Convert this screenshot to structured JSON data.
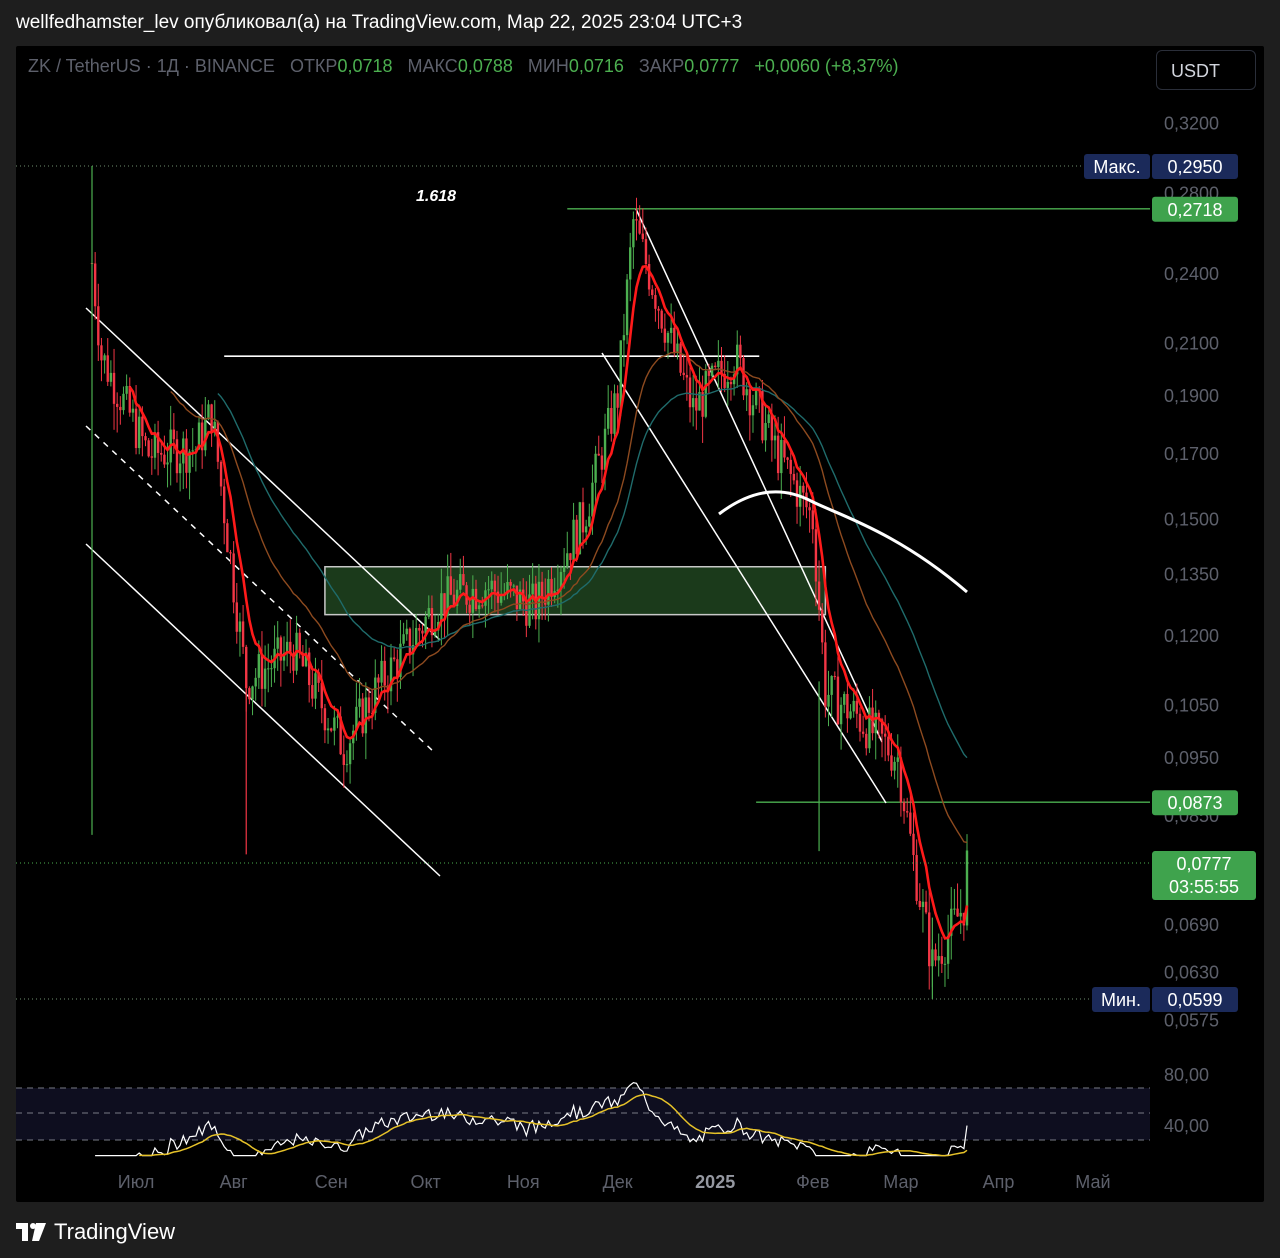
{
  "header": {
    "text": "wellfedhamster_lev опубликовал(а) на TradingView.com, Мар 22, 2025 23:04 UTC+3"
  },
  "legend": {
    "symbol": "ZK / TetherUS · 1Д · BINANCE",
    "open_label": "ОТКР",
    "open": "0,0718",
    "high_label": "МАКС",
    "high": "0,0788",
    "low_label": "МИН",
    "low": "0,0716",
    "close_label": "ЗАКР",
    "close": "0,0777",
    "change": "+0,0060 (+8,37%)"
  },
  "currency_button": "USDT",
  "footer": {
    "brand": "TradingView"
  },
  "colors": {
    "up": "#4caf50",
    "down": "#f23645",
    "ema_fast": "#ff1a1a",
    "ema_mid": "#8d4a1f",
    "ema_slow": "#1f6b6b",
    "sma_long": "#ffffff",
    "zone": "#1b3a1b",
    "label_green": "#3fa34d",
    "label_navy": "#1b2a5a",
    "rsi": "#ffffff",
    "rsi_ma": "#e6c229"
  },
  "chart_data": {
    "type": "candlestick",
    "price_axis_ticks": [
      "0,3200",
      "0,2800",
      "0,2400",
      "0,2100",
      "0,1900",
      "0,1700",
      "0,1500",
      "0,1350",
      "0,1200",
      "0,1050",
      "0,0950",
      "0,0850",
      "0,0690",
      "0,0630",
      "0,0575"
    ],
    "time_axis_ticks": [
      "Июл",
      "Авг",
      "Сен",
      "Окт",
      "Ноя",
      "Дек",
      "2025",
      "Фев",
      "Мар",
      "Апр",
      "Май"
    ],
    "time_range": [
      "2024-06-17",
      "2025-03-22"
    ],
    "labels": {
      "max": {
        "title": "Макс.",
        "value": "0,2950"
      },
      "fib_level": {
        "value": "0,2718",
        "text": "1.618"
      },
      "support": {
        "value": "0,0873"
      },
      "last": {
        "value": "0,0777",
        "countdown": "03:55:55"
      },
      "min": {
        "title": "Мин.",
        "value": "0,0599"
      }
    },
    "zone": {
      "from": "2024-08-30",
      "to": "2025-02-05",
      "low": 0.125,
      "high": 0.137
    },
    "horizontal_lines": [
      {
        "from": "2024-07-29",
        "to": "2025-01-15",
        "price": 0.205
      },
      {
        "from": "2024-11-15",
        "to": "2025-03-22",
        "price": 0.2718
      },
      {
        "from": "2025-01-14",
        "to": "2025-03-22",
        "price": 0.0873
      }
    ],
    "candles_summary": {
      "start_price": 0.245,
      "key_points": [
        [
          "2024-06-17",
          0.245
        ],
        [
          "2024-06-20",
          0.205
        ],
        [
          "2024-07-05",
          0.17
        ],
        [
          "2024-07-20",
          0.172
        ],
        [
          "2024-07-25",
          0.184
        ],
        [
          "2024-08-05",
          0.11
        ],
        [
          "2024-08-20",
          0.117
        ],
        [
          "2024-09-05",
          0.097
        ],
        [
          "2024-09-15",
          0.108
        ],
        [
          "2024-10-05",
          0.128
        ],
        [
          "2024-10-20",
          0.132
        ],
        [
          "2024-11-05",
          0.127
        ],
        [
          "2024-11-20",
          0.15
        ],
        [
          "2024-12-01",
          0.19
        ],
        [
          "2024-12-06",
          0.265
        ],
        [
          "2024-12-18",
          0.21
        ],
        [
          "2024-12-25",
          0.185
        ],
        [
          "2025-01-07",
          0.205
        ],
        [
          "2025-01-20",
          0.172
        ],
        [
          "2025-02-01",
          0.15
        ],
        [
          "2025-02-05",
          0.108
        ],
        [
          "2025-02-15",
          0.103
        ],
        [
          "2025-02-28",
          0.095
        ],
        [
          "2025-03-05",
          0.078
        ],
        [
          "2025-03-11",
          0.064
        ],
        [
          "2025-03-21",
          0.0717
        ],
        [
          "2025-03-22",
          0.0777
        ]
      ]
    },
    "rsi_axis_ticks": [
      "80,00",
      "40,00"
    ]
  }
}
